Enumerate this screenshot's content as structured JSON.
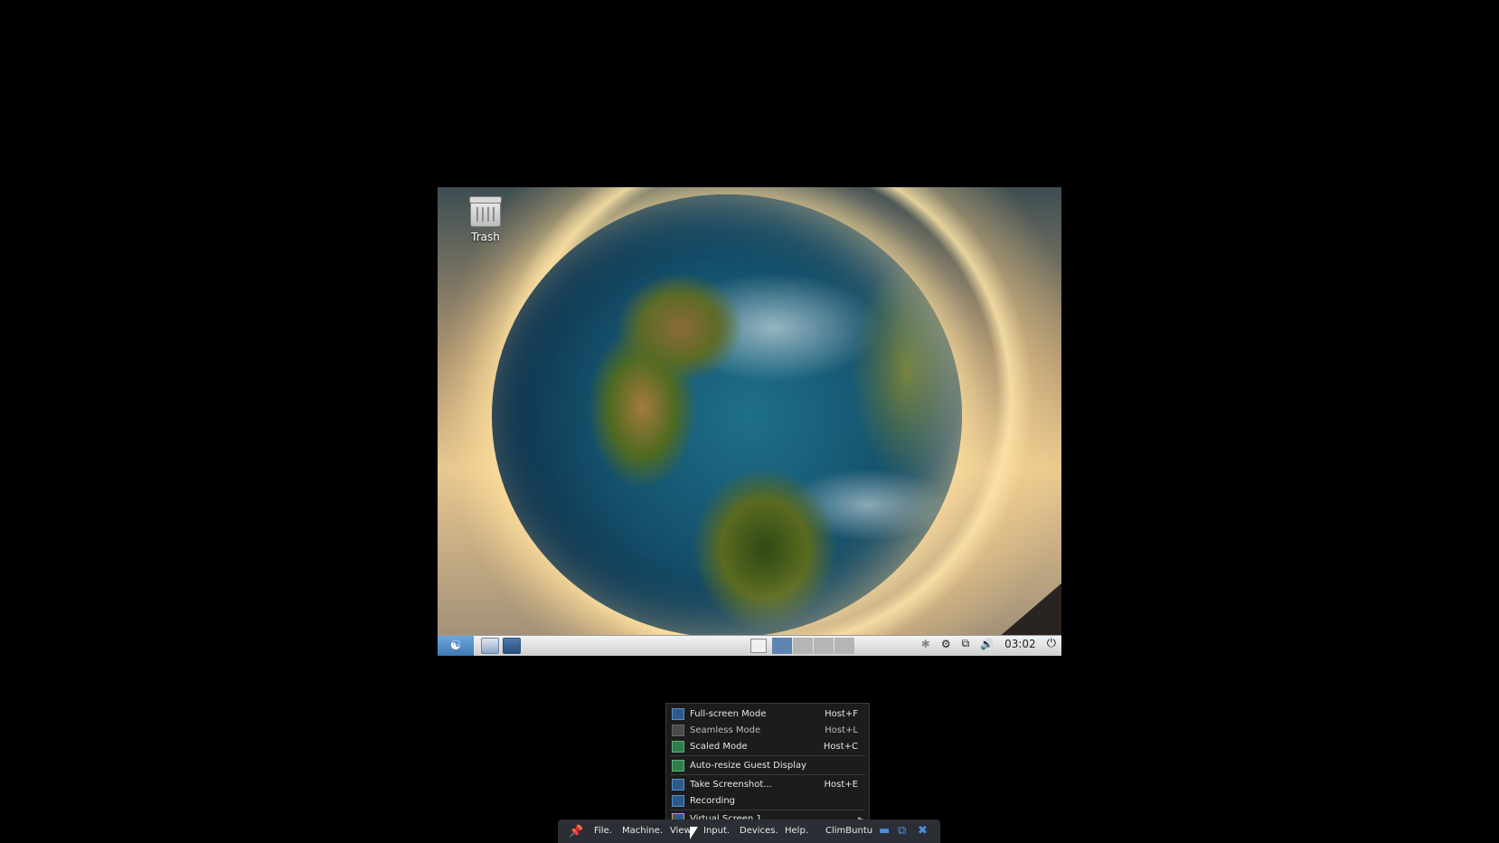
{
  "desktop": {
    "trash_label": "Trash"
  },
  "panel": {
    "clock": "03:02",
    "workspaces": 4,
    "active_workspace": 1
  },
  "view_menu": {
    "items": [
      {
        "label": "Full-screen Mode",
        "shortcut": "Host+F"
      },
      {
        "label": "Seamless Mode",
        "shortcut": "Host+L"
      },
      {
        "label": "Scaled Mode",
        "shortcut": "Host+C"
      },
      {
        "label": "Auto-resize Guest Display",
        "shortcut": ""
      },
      {
        "label": "Take Screenshot...",
        "shortcut": "Host+E"
      },
      {
        "label": "Recording",
        "shortcut": ""
      },
      {
        "label": "Virtual Screen 1",
        "shortcut": ""
      }
    ]
  },
  "mini_toolbar": {
    "menus": [
      "File",
      "Machine",
      "View",
      "Input",
      "Devices",
      "Help"
    ],
    "vm_name": "ClimBuntu"
  },
  "colors": {
    "menu_bg": "#1c1c1c",
    "toolbar_bg": "#2b2f35",
    "accent": "#4e8fe0"
  }
}
